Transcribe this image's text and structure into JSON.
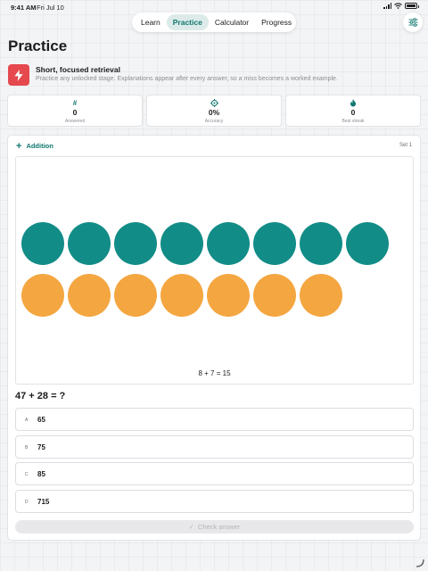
{
  "status_bar": {
    "time": "9:41 AM",
    "date": "Fri Jul 10"
  },
  "nav": {
    "tabs": [
      "Learn",
      "Practice",
      "Calculator",
      "Progress"
    ],
    "active": "Practice"
  },
  "page": {
    "title": "Practice"
  },
  "intro": {
    "title": "Short, focused retrieval",
    "description": "Practice any unlocked stage. Explanations appear after every answer, so a miss becomes a worked example."
  },
  "stats": [
    {
      "icon": "#",
      "value": "0",
      "label": "Answered"
    },
    {
      "icon": "target-icon",
      "value": "0%",
      "label": "Accuracy"
    },
    {
      "icon": "flame-icon",
      "value": "0",
      "label": "Best streak"
    }
  ],
  "card": {
    "topic": "Addition",
    "set_label": "Set 1",
    "visual": {
      "top_count": 8,
      "bottom_count": 7,
      "top_color": "#128c87",
      "bottom_color": "#f4a640",
      "equation": "8 + 7 = 15"
    },
    "question": "47 + 28 = ?",
    "options": [
      {
        "letter": "A",
        "value": "65"
      },
      {
        "letter": "B",
        "value": "75"
      },
      {
        "letter": "C",
        "value": "85"
      },
      {
        "letter": "D",
        "value": "715"
      }
    ],
    "check_label": "Check answer"
  },
  "colors": {
    "accent": "#0f766e",
    "bolt_bg": "#e5484d"
  }
}
